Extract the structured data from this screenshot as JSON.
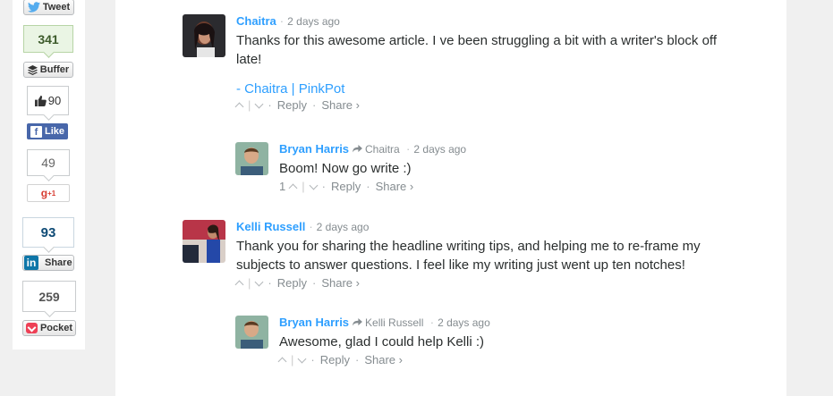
{
  "share_bar": {
    "tweet_label": "Tweet",
    "buffer_count": "341",
    "buffer_label": "Buffer",
    "like_count": "90",
    "fb_like_label": "Like",
    "gplus_count": "49",
    "gplus_label": "+1",
    "linkedin_count": "93",
    "linkedin_label": "Share",
    "pocket_count": "259",
    "pocket_label": "Pocket"
  },
  "comments": [
    {
      "author": "Chaitra",
      "time": "2 days ago",
      "text": "Thanks for this awesome article. I ve been struggling a bit with a writer's block off late!",
      "signature": "- Chaitra | PinkPot",
      "votes": "",
      "reply_label": "Reply",
      "share_label": "Share ›"
    },
    {
      "author": "Bryan Harris",
      "reply_to": "Chaitra",
      "time": "2 days ago",
      "text": "Boom! Now go write :)",
      "votes": "1",
      "reply_label": "Reply",
      "share_label": "Share ›"
    },
    {
      "author": "Kelli Russell",
      "time": "2 days ago",
      "text": "Thank you for sharing the headline writing tips, and helping me to re-frame my subjects to answer questions. I feel like my writing just went up ten notches!",
      "votes": "",
      "reply_label": "Reply",
      "share_label": "Share ›"
    },
    {
      "author": "Bryan Harris",
      "reply_to": "Kelli Russell",
      "time": "2 days ago",
      "text": "Awesome, glad I could help Kelli :)",
      "votes": "",
      "reply_label": "Reply",
      "share_label": "Share ›"
    }
  ],
  "icons": {
    "twitter": "bird-icon",
    "buffer": "stack-icon",
    "like": "thumbs-up-icon",
    "facebook": "facebook-icon",
    "google_plus": "google-plus-icon",
    "linkedin": "linkedin-icon",
    "pocket": "pocket-icon",
    "reply_arrow": "reply-arrow-icon"
  },
  "colors": {
    "accent": "#2e9fff",
    "facebook": "#4867aa",
    "linkedin": "#0e76a8",
    "pocket": "#ee4056",
    "twitter": "#55acee"
  }
}
